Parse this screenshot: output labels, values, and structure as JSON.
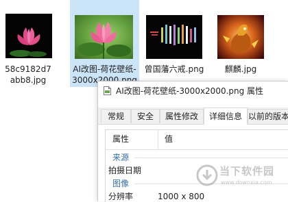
{
  "explorer": {
    "files": [
      {
        "name": "58c9182d7abb8.jpg",
        "thumbnail_icon": "lotus-dark-photo"
      },
      {
        "name": "AI改图-荷花壁纸-3000x2000.png",
        "thumbnail_icon": "lotus-green-photo",
        "selected": true
      },
      {
        "name": "曾国藩六戒.png",
        "thumbnail_icon": "calligraphy-dark-image"
      },
      {
        "name": "麒麟.jpg",
        "thumbnail_icon": "qilin-fire-image"
      }
    ]
  },
  "dialog": {
    "title": "AI改图-荷花壁纸-3000x2000.png 属性",
    "tabs": [
      {
        "label": "常规"
      },
      {
        "label": "安全"
      },
      {
        "label": "属性修改"
      },
      {
        "label": "详细信息",
        "active": true
      },
      {
        "label": "以前的版本"
      }
    ],
    "columns": {
      "property": "属性",
      "value": "值"
    },
    "sections": [
      {
        "label": "来源",
        "rows": [
          {
            "property": "拍摄日期",
            "value": ""
          }
        ]
      },
      {
        "label": "图像",
        "rows": [
          {
            "property": "分辨率",
            "value": "1000 x 800"
          }
        ]
      }
    ]
  },
  "watermark": {
    "text": "当下软件园",
    "url": "www.downxia.com"
  },
  "colors": {
    "selection": "#cce4f7",
    "section_label": "#3a6ea5",
    "tab_bar": "#f0f0f0"
  }
}
